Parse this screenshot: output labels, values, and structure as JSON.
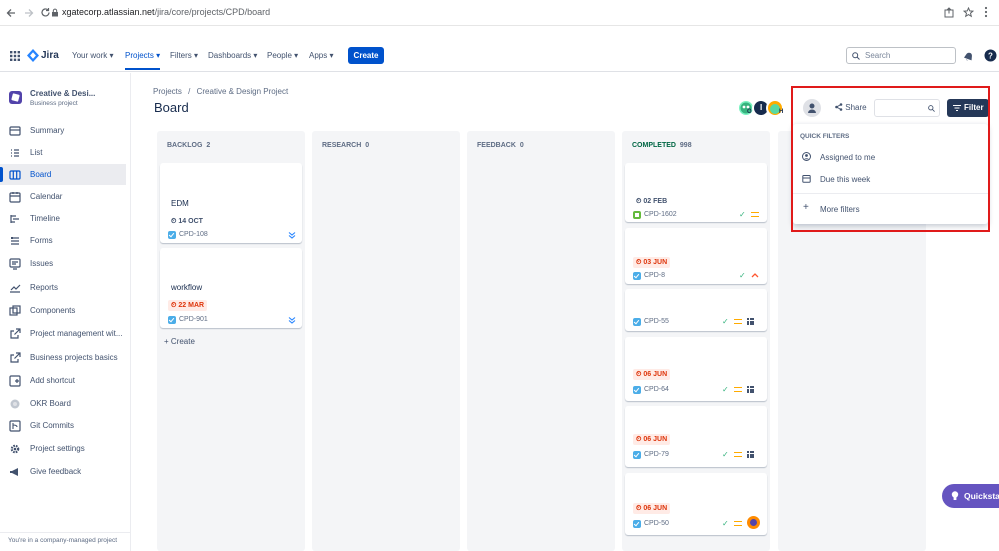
{
  "browser": {
    "url_domain": "xgatecorp.atlassian.net",
    "url_path": "/jira/core/projects/CPD/board"
  },
  "nav": {
    "product": "Jira",
    "items": [
      "Your work",
      "Projects",
      "Filters",
      "Dashboards",
      "People",
      "Apps"
    ],
    "create_label": "Create",
    "search_placeholder": "Search"
  },
  "project": {
    "name": "Creative & Desi...",
    "type": "Business project"
  },
  "sidebar": {
    "items": [
      {
        "label": "Summary",
        "icon": "summary-icon"
      },
      {
        "label": "List",
        "icon": "list-icon"
      },
      {
        "label": "Board",
        "icon": "board-icon"
      },
      {
        "label": "Calendar",
        "icon": "calendar-icon"
      },
      {
        "label": "Timeline",
        "icon": "timeline-icon"
      },
      {
        "label": "Forms",
        "icon": "forms-icon"
      },
      {
        "label": "Issues",
        "icon": "issues-icon"
      },
      {
        "label": "Reports",
        "icon": "reports-icon"
      },
      {
        "label": "Components",
        "icon": "components-icon"
      },
      {
        "label": "Project management wit...",
        "icon": "external-link-icon"
      },
      {
        "label": "Business projects basics",
        "icon": "external-link-icon"
      },
      {
        "label": "Add shortcut",
        "icon": "add-shortcut-icon"
      },
      {
        "label": "OKR Board",
        "icon": "okr-icon"
      },
      {
        "label": "Git Commits",
        "icon": "git-icon"
      },
      {
        "label": "Project settings",
        "icon": "gear-icon"
      },
      {
        "label": "Give feedback",
        "icon": "megaphone-icon"
      }
    ],
    "footer": "You're in a company-managed project"
  },
  "header": {
    "breadcrumb_projects": "Projects",
    "breadcrumb_sep": "/",
    "breadcrumb_project": "Creative & Design Project",
    "title": "Board",
    "share_label": "Share",
    "filter_label": "Filter"
  },
  "filter_dropdown": {
    "heading": "QUICK FILTERS",
    "items": [
      "Assigned to me",
      "Due this week",
      "More filters"
    ]
  },
  "columns": [
    {
      "name": "BACKLOG",
      "count": "2"
    },
    {
      "name": "RESEARCH",
      "count": "0"
    },
    {
      "name": "FEEDBACK",
      "count": "0"
    },
    {
      "name": "COMPLETED",
      "count": "998"
    }
  ],
  "backlog_cards": [
    {
      "title": "EDM",
      "date": "14 OCT",
      "key": "CPD-108"
    },
    {
      "title": "workflow",
      "date": "22 MAR",
      "key": "CPD-901"
    }
  ],
  "backlog_create": "Create",
  "completed_cards": [
    {
      "date": "02 FEB",
      "key": "CPD-1602"
    },
    {
      "date": "03 JUN",
      "key": "CPD-8"
    },
    {
      "date": "",
      "key": "CPD-55"
    },
    {
      "date": "06 JUN",
      "key": "CPD-64"
    },
    {
      "date": "06 JUN",
      "key": "CPD-79"
    },
    {
      "date": "06 JUN",
      "key": "CPD-50"
    }
  ],
  "avatars": [
    "O",
    "I",
    "H"
  ],
  "quickstart": "Quicksta",
  "colors": {
    "primary": "#0052cc",
    "dark_button": "#253858",
    "highlight": "#e01a1a",
    "quickstart": "#6554c0"
  }
}
